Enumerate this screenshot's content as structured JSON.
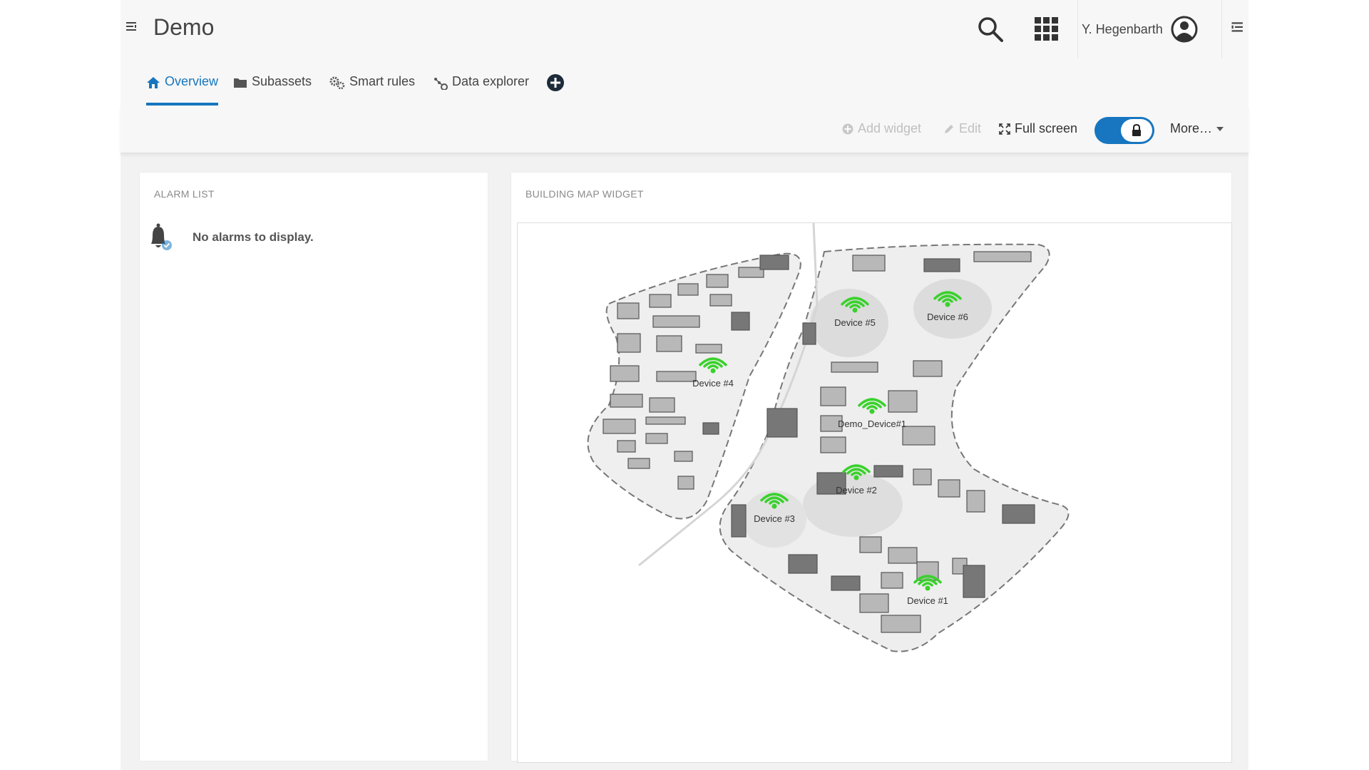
{
  "header": {
    "app_title": "Demo",
    "user_name": "Y. Hegenbarth"
  },
  "tabs": [
    {
      "label": "Overview",
      "icon": "home-icon",
      "active": true
    },
    {
      "label": "Subassets",
      "icon": "folder-icon",
      "active": false
    },
    {
      "label": "Smart rules",
      "icon": "gears-icon",
      "active": false
    },
    {
      "label": "Data explorer",
      "icon": "data-explorer-icon",
      "active": false
    }
  ],
  "toolbar": {
    "add_widget": "Add widget",
    "edit": "Edit",
    "full_screen": "Full screen",
    "more": "More…",
    "locked": true
  },
  "alarm_widget": {
    "title": "ALARM LIST",
    "empty_message": "No alarms to display."
  },
  "map_widget": {
    "title": "BUILDING MAP WIDGET",
    "devices": [
      {
        "name": "Device #1"
      },
      {
        "name": "Device #2"
      },
      {
        "name": "Device #3"
      },
      {
        "name": "Device #4"
      },
      {
        "name": "Device #5"
      },
      {
        "name": "Device #6"
      },
      {
        "name": "Demo_Device#1"
      }
    ]
  },
  "colors": {
    "accent": "#1776bf",
    "device_signal": "#3ad12d"
  }
}
